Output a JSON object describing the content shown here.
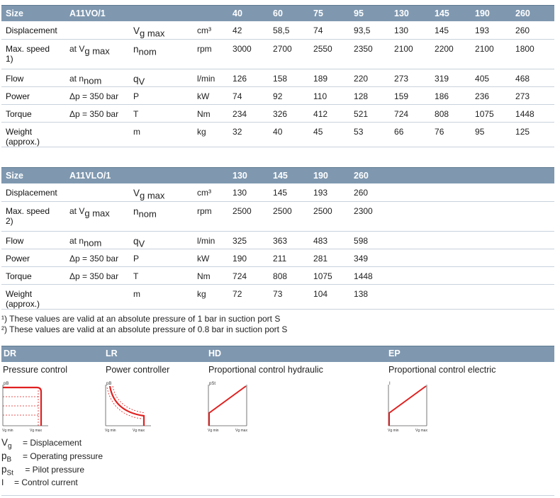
{
  "table1": {
    "size_label": "Size",
    "model": "A11VO/1",
    "sizes": [
      "40",
      "60",
      "75",
      "95",
      "130",
      "145",
      "190",
      "260"
    ],
    "rows": [
      {
        "label": "Displacement",
        "cond": "",
        "sym": "V",
        "sym_sub": "g max",
        "unit": "cm³",
        "values": [
          "42",
          "58,5",
          "74",
          "93,5",
          "130",
          "145",
          "193",
          "260"
        ],
        "tall": false
      },
      {
        "label": "Max. speed",
        "label2": "1)",
        "cond": "at V",
        "cond_sub": "g max",
        "sym": "n",
        "sym_sub": "nom",
        "unit": "rpm",
        "values": [
          "3000",
          "2700",
          "2550",
          "2350",
          "2100",
          "2200",
          "2100",
          "1800"
        ],
        "tall": true
      },
      {
        "label": "Flow",
        "cond": "at n",
        "cond_sub": "nom",
        "sym": "q",
        "sym_sub": "V",
        "unit": "l/min",
        "values": [
          "126",
          "158",
          "189",
          "220",
          "273",
          "319",
          "405",
          "468"
        ],
        "tall": false
      },
      {
        "label": "Power",
        "cond": "Δp = 350 bar",
        "sym": "P",
        "unit": "kW",
        "values": [
          "74",
          "92",
          "110",
          "128",
          "159",
          "186",
          "236",
          "273"
        ],
        "tall": false
      },
      {
        "label": "Torque",
        "cond": "Δp = 350 bar",
        "sym": "T",
        "unit": "Nm",
        "values": [
          "234",
          "326",
          "412",
          "521",
          "724",
          "808",
          "1075",
          "1448"
        ],
        "tall": false
      },
      {
        "label": "Weight (approx.)",
        "cond": "",
        "sym": "m",
        "unit": "kg",
        "values": [
          "32",
          "40",
          "45",
          "53",
          "66",
          "76",
          "95",
          "125"
        ],
        "tall": false
      }
    ]
  },
  "table2": {
    "size_label": "Size",
    "model": "A11VLO/1",
    "sizes": [
      "130",
      "145",
      "190",
      "260"
    ],
    "rows": [
      {
        "label": "Displacement",
        "cond": "",
        "sym": "V",
        "sym_sub": "g max",
        "unit": "cm³",
        "values": [
          "130",
          "145",
          "193",
          "260"
        ],
        "tall": false
      },
      {
        "label": "Max. speed",
        "label2": "2)",
        "cond": "at V",
        "cond_sub": "g max",
        "sym": "n",
        "sym_sub": "nom",
        "unit": "rpm",
        "values": [
          "2500",
          "2500",
          "2500",
          "2300"
        ],
        "tall": true
      },
      {
        "label": "Flow",
        "cond": "at n",
        "cond_sub": "nom",
        "sym": "q",
        "sym_sub": "V",
        "unit": "l/min",
        "values": [
          "325",
          "363",
          "483",
          "598"
        ],
        "tall": false
      },
      {
        "label": "Power",
        "cond": "Δp = 350 bar",
        "sym": "P",
        "unit": "kW",
        "values": [
          "190",
          "211",
          "281",
          "349"
        ],
        "tall": false
      },
      {
        "label": "Torque",
        "cond": "Δp = 350 bar",
        "sym": "T",
        "unit": "Nm",
        "values": [
          "724",
          "808",
          "1075",
          "1448"
        ],
        "tall": false
      },
      {
        "label": "Weight (approx.)",
        "cond": "",
        "sym": "m",
        "unit": "kg",
        "values": [
          "72",
          "73",
          "104",
          "138"
        ],
        "tall": false
      }
    ]
  },
  "footnotes": {
    "n1": "¹)  These values are valid at an absolute pressure of 1 bar in suction port S",
    "n2": "²)  These values are valid at an absolute pressure of 0.8 bar in suction port S"
  },
  "controls": [
    {
      "code": "DR",
      "name": "Pressure control",
      "y_axis": "pB",
      "x_min": "Vg min",
      "x_max": "Vg max"
    },
    {
      "code": "LR",
      "name": "Power controller",
      "y_axis": "pB",
      "x_min": "Vg min",
      "x_max": "Vg max"
    },
    {
      "code": "HD",
      "name": "Proportional control hydraulic",
      "y_axis": "pSt",
      "x_min": "Vg min",
      "x_max": "Vg max"
    },
    {
      "code": "EP",
      "name": "Proportional control electric",
      "y_axis": "I",
      "x_min": "Vg min",
      "x_max": "Vg max"
    }
  ],
  "legend": [
    {
      "sym": "V",
      "sub": "g",
      "text": "= Displacement"
    },
    {
      "sym": "p",
      "sub": "B",
      "text": "= Operating pressure"
    },
    {
      "sym": "p",
      "sub": "St",
      "text": " = Pilot pressure"
    },
    {
      "sym": "I",
      "sub": "",
      "text": "= Control current"
    }
  ],
  "colors": {
    "header": "#7f98b0",
    "curve": "#e02020",
    "divider": "#c8d2dc"
  }
}
